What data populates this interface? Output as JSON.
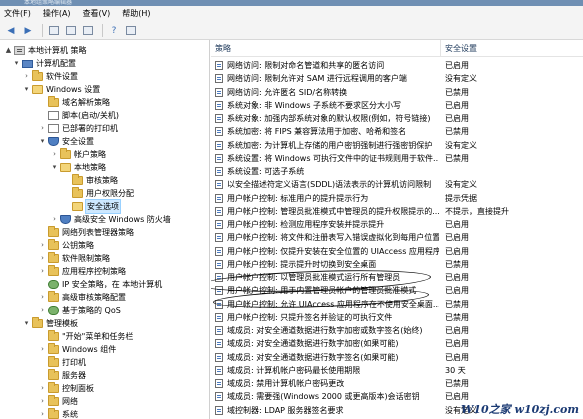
{
  "window": {
    "title": "本地组策略编辑器"
  },
  "menu": [
    "文件(F)",
    "操作(A)",
    "查看(V)",
    "帮助(H)"
  ],
  "toolbar": [
    {
      "icon": "back-arrow-icon",
      "glyph": "◀"
    },
    {
      "icon": "forward-arrow-icon",
      "glyph": "▶"
    },
    {
      "icon": "up-folder-icon",
      "glyph": ""
    },
    {
      "icon": "show-tree-icon",
      "glyph": ""
    },
    {
      "icon": "export-list-icon",
      "glyph": ""
    },
    {
      "icon": "help-icon",
      "glyph": "?"
    },
    {
      "icon": "properties-icon",
      "glyph": ""
    }
  ],
  "tree": [
    {
      "label": "本地计算机 策略",
      "icon": "policy",
      "name": "tree-item-local-computer-policy",
      "toggle": "▲"
    },
    {
      "label": "计算机配置",
      "icon": "computer",
      "name": "tree-item-computer-configuration",
      "toggle": "▾"
    },
    {
      "label": "软件设置",
      "icon": "folder",
      "name": "tree-item-software-settings",
      "toggle": "›"
    },
    {
      "label": "Windows 设置",
      "icon": "folder-open",
      "name": "tree-item-windows-settings",
      "toggle": "▾"
    },
    {
      "label": "域名解析策略",
      "icon": "folder",
      "name": "tree-item-name-resolution-policy",
      "toggle": ""
    },
    {
      "label": "脚本(启动/关机)",
      "icon": "doc",
      "name": "tree-item-scripts",
      "toggle": ""
    },
    {
      "label": "已部署的打印机",
      "icon": "doc",
      "name": "tree-item-deployed-printers",
      "toggle": "›"
    },
    {
      "label": "安全设置",
      "icon": "shield",
      "name": "tree-item-security-settings",
      "toggle": "▾"
    },
    {
      "label": "帐户策略",
      "icon": "folder",
      "name": "tree-item-account-policies",
      "toggle": "›"
    },
    {
      "label": "本地策略",
      "icon": "folder-open",
      "name": "tree-item-local-policies",
      "toggle": "▾"
    },
    {
      "label": "审核策略",
      "icon": "folder",
      "name": "tree-item-audit-policy",
      "toggle": ""
    },
    {
      "label": "用户权限分配",
      "icon": "folder",
      "name": "tree-item-user-rights-assignment",
      "toggle": ""
    },
    {
      "label": "安全选项",
      "icon": "folder-open",
      "name": "tree-item-security-options",
      "toggle": "",
      "selected": true
    },
    {
      "label": "高级安全 Windows 防火墙",
      "icon": "shield",
      "name": "tree-item-advanced-firewall",
      "toggle": "›"
    },
    {
      "label": "网络列表管理器策略",
      "icon": "folder",
      "name": "tree-item-network-list-manager",
      "toggle": ""
    },
    {
      "label": "公钥策略",
      "icon": "folder",
      "name": "tree-item-public-key-policies",
      "toggle": "›"
    },
    {
      "label": "软件限制策略",
      "icon": "folder",
      "name": "tree-item-software-restriction",
      "toggle": "›"
    },
    {
      "label": "应用程序控制策略",
      "icon": "folder",
      "name": "tree-item-app-control-policies",
      "toggle": "›"
    },
    {
      "label": "IP 安全策略，在 本地计算机",
      "icon": "net",
      "name": "tree-item-ip-security",
      "toggle": ""
    },
    {
      "label": "高级审核策略配置",
      "icon": "folder",
      "name": "tree-item-advanced-audit",
      "toggle": "›"
    },
    {
      "label": "基于策略的 QoS",
      "icon": "net",
      "name": "tree-item-qos",
      "toggle": "›"
    },
    {
      "label": "管理模板",
      "icon": "folder",
      "name": "tree-item-administrative-templates",
      "toggle": "▾"
    },
    {
      "label": "\"开始\"菜单和任务栏",
      "icon": "folder",
      "name": "tree-item-start-menu-taskbar",
      "toggle": ""
    },
    {
      "label": "Windows 组件",
      "icon": "folder",
      "name": "tree-item-windows-components",
      "toggle": "›"
    },
    {
      "label": "打印机",
      "icon": "folder",
      "name": "tree-item-printers",
      "toggle": ""
    },
    {
      "label": "服务器",
      "icon": "folder",
      "name": "tree-item-server",
      "toggle": ""
    },
    {
      "label": "控制面板",
      "icon": "folder",
      "name": "tree-item-control-panel",
      "toggle": "›"
    },
    {
      "label": "网络",
      "icon": "folder",
      "name": "tree-item-network",
      "toggle": "›"
    },
    {
      "label": "系统",
      "icon": "folder",
      "name": "tree-item-system",
      "toggle": "›"
    }
  ],
  "list": {
    "columns": {
      "policy": "策略",
      "setting": "安全设置"
    },
    "rows": [
      {
        "policy": "网络访问: 限制对命名管道和共享的匿名访问",
        "setting": "已启用"
      },
      {
        "policy": "网络访问: 限制允许对 SAM 进行远程调用的客户端",
        "setting": "没有定义"
      },
      {
        "policy": "网络访问: 允许匿名 SID/名称转换",
        "setting": "已禁用"
      },
      {
        "policy": "系统对象: 非 Windows 子系统不要求区分大小写",
        "setting": "已启用"
      },
      {
        "policy": "系统对象: 加强内部系统对象的默认权限(例如，符号链接)",
        "setting": "已启用"
      },
      {
        "policy": "系统加密: 将 FIPS 兼容算法用于加密、哈希和签名",
        "setting": "已禁用"
      },
      {
        "policy": "系统加密: 为计算机上存储的用户密钥强制进行强密钥保护",
        "setting": "没有定义"
      },
      {
        "policy": "系统设置: 将 Windows 可执行文件中的证书规则用于软件...",
        "setting": "已禁用"
      },
      {
        "policy": "系统设置: 可选子系统",
        "setting": ""
      },
      {
        "policy": "以安全描述符定义语言(SDDL)语法表示的计算机访问限制",
        "setting": "没有定义"
      },
      {
        "policy": "用户帐户控制: 标准用户的提升提示行为",
        "setting": "提示凭据"
      },
      {
        "policy": "用户帐户控制: 管理员批准模式中管理员的提升权限提示的...",
        "setting": "不提示，直接提升"
      },
      {
        "policy": "用户帐户控制: 检测应用程序安装并提示提升",
        "setting": "已启用"
      },
      {
        "policy": "用户帐户控制: 将文件和注册表写入错误虚拟化到每用户位置",
        "setting": "已启用"
      },
      {
        "policy": "用户帐户控制: 仅提升安装在安全位置的 UIAccess 应用程序",
        "setting": "已启用"
      },
      {
        "policy": "用户帐户控制: 提示提升时切换到安全桌面",
        "setting": "已禁用"
      },
      {
        "policy": "用户帐户控制: 以管理员批准模式运行所有管理员",
        "setting": "已启用"
      },
      {
        "policy": "用户帐户控制: 用于内置管理员帐户的管理员批准模式",
        "setting": "已启用"
      },
      {
        "policy": "用户帐户控制: 允许 UIAccess 应用程序在不使用安全桌面...",
        "setting": "已禁用"
      },
      {
        "policy": "用户帐户控制: 只提升签名并验证的可执行文件",
        "setting": "已禁用"
      },
      {
        "policy": "域成员: 对安全通道数据进行数字加密或数字签名(始终)",
        "setting": "已启用"
      },
      {
        "policy": "域成员: 对安全通道数据进行数字加密(如果可能)",
        "setting": "已启用"
      },
      {
        "policy": "域成员: 对安全通道数据进行数字签名(如果可能)",
        "setting": "已启用"
      },
      {
        "policy": "域成员: 计算机帐户密码最长使用期限",
        "setting": "30 天"
      },
      {
        "policy": "域成员: 禁用计算机帐户密码更改",
        "setting": "已禁用"
      },
      {
        "policy": "域成员: 需要强(Windows 2000 或更高版本)会话密钥",
        "setting": "已启用"
      },
      {
        "policy": "域控制器: LDAP 服务器签名要求",
        "setting": "没有定义"
      }
    ]
  },
  "watermark": "W10之家 w10zj.com"
}
